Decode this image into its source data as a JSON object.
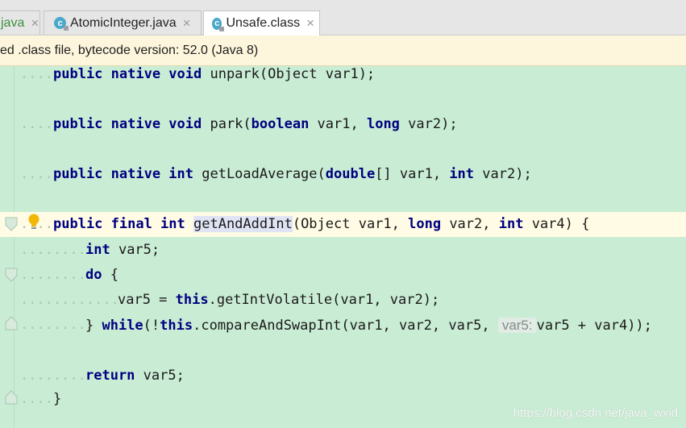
{
  "tabs": [
    {
      "label": "java",
      "has_icon": false,
      "active": false
    },
    {
      "label": "AtomicInteger.java",
      "has_icon": true,
      "active": false
    },
    {
      "label": "Unsafe.class",
      "has_icon": true,
      "active": true
    }
  ],
  "close_glyph": "×",
  "banner": {
    "text": "ed .class file, bytecode version: 52.0 (Java 8)"
  },
  "editor": {
    "background": "#c9ecd4",
    "keyword_color": "#000080",
    "lines": {
      "l1": {
        "dots": "....",
        "kw": "public native void ",
        "rest": "unpark(Object var1);"
      },
      "l2": {
        "dots": "....",
        "kw1": "public native void ",
        "t1": "park(",
        "kw2": "boolean",
        "t2": " var1, ",
        "kw3": "long",
        "t3": " var2);"
      },
      "l3": {
        "dots": "....",
        "kw1": "public native int ",
        "t1": "getLoadAverage(",
        "kw2": "double",
        "t2": "[] var1, ",
        "kw3": "int",
        "t3": " var2);"
      },
      "l4": {
        "dots": "....",
        "kw1": "public final int ",
        "method": "getAndAddInt",
        "t1": "(Object var1, ",
        "kw2": "long",
        "t2": " var2, ",
        "kw3": "int",
        "t3": " var4) {"
      },
      "l5": {
        "dots": "........",
        "kw": "int",
        "rest": " var5;"
      },
      "l6": {
        "dots": "........",
        "kw": "do",
        "rest": " {"
      },
      "l7": {
        "dots": "............",
        "rest1": "var5 = ",
        "kw": "this",
        "rest2": ".getIntVolatile(var1, var2);"
      },
      "l8": {
        "dots": "........",
        "t1": "} ",
        "kw1": "while",
        "t2": "(!",
        "kw2": "this",
        "t3": ".compareAndSwapInt(var1, var2, var5, ",
        "hint": "var5:",
        "t4": "var5 + var4));"
      },
      "l9": {
        "dots": "........",
        "kw": "return",
        "rest": " var5;"
      },
      "l10": {
        "dots": "....",
        "rest": "}"
      }
    }
  },
  "watermark": "https://blog.csdn.net/java_wxid"
}
